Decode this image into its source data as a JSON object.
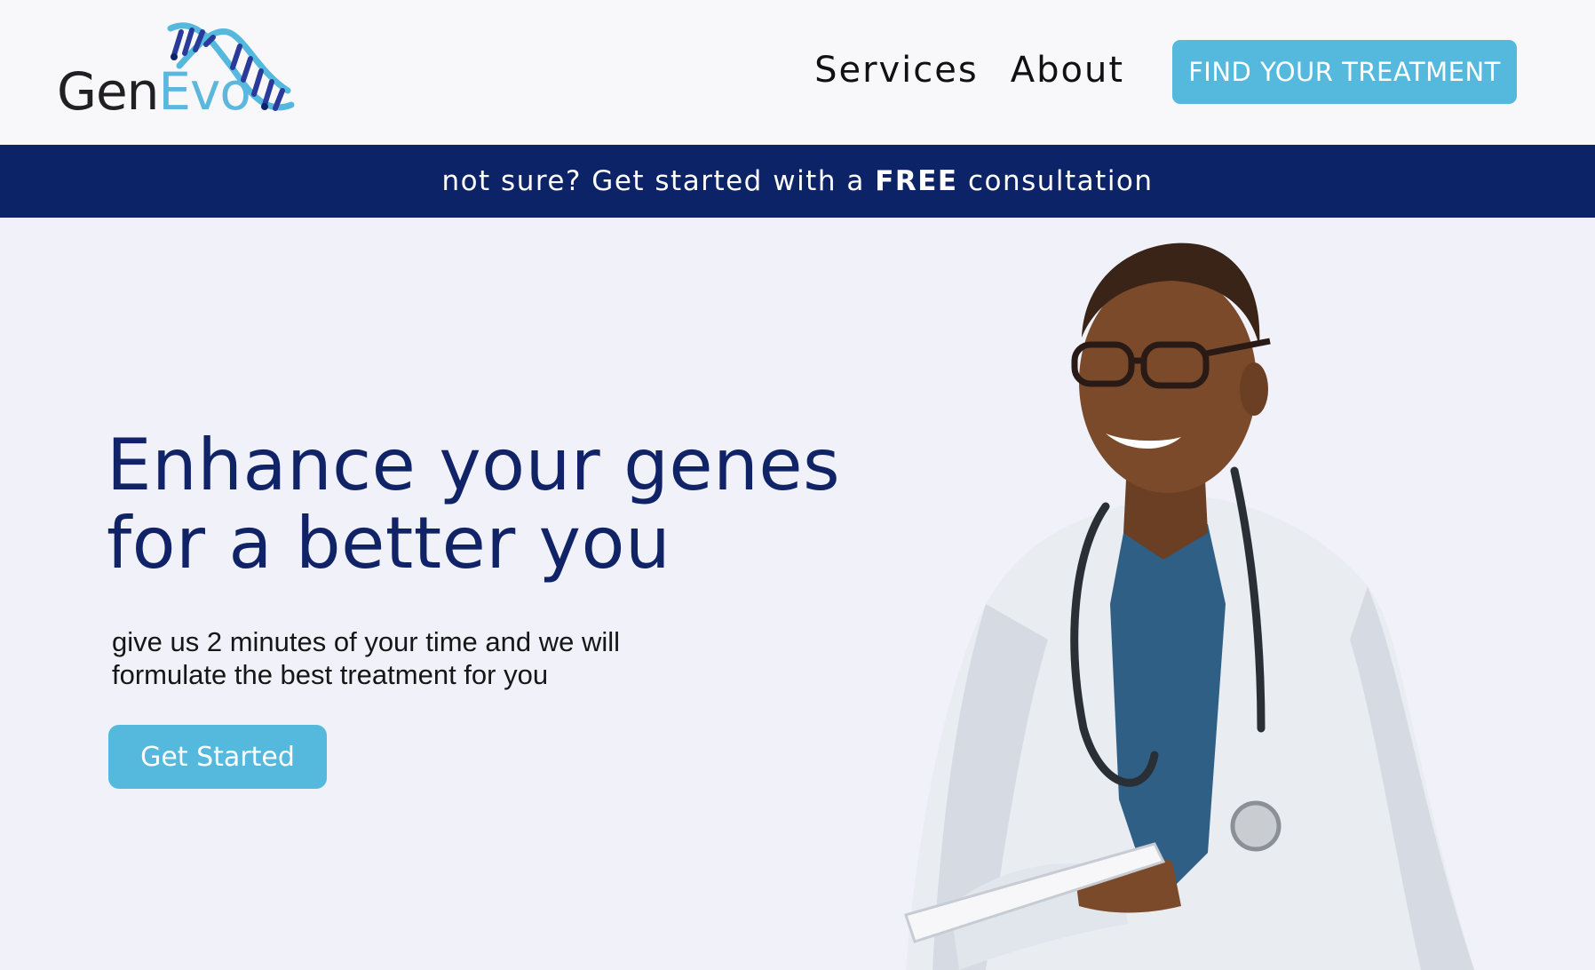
{
  "header": {
    "logo": {
      "part1": "Gen",
      "part2": "Evo"
    },
    "nav": [
      {
        "label": "Services"
      },
      {
        "label": "About"
      }
    ],
    "cta_label": "FIND YOUR TREATMENT"
  },
  "banner": {
    "prefix": "not sure? Get started with a ",
    "emphasis": "FREE",
    "suffix": " consultation"
  },
  "hero": {
    "title_line1": "Enhance your genes",
    "title_line2": "for a better you",
    "subtitle_line1": "give us 2 minutes of your time and we will",
    "subtitle_line2": "formulate the best treatment for you",
    "cta_label": "Get Started"
  },
  "colors": {
    "brand_navy": "#0d2367",
    "brand_blue": "#55b9de",
    "page_bg": "#f0f1f9",
    "header_bg": "#f8f8fa"
  },
  "icons": [
    "dna-helix-icon"
  ]
}
